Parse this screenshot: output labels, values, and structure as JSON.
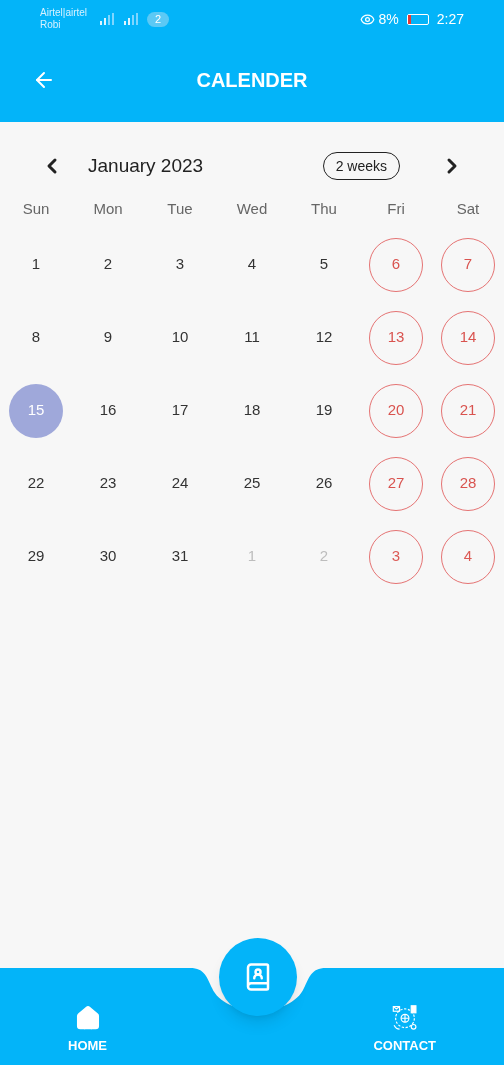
{
  "status_bar": {
    "carrier_1": "Airtel|airtel",
    "carrier_2": "Robi",
    "sim_badge": "2",
    "battery": "8%",
    "time": "2:27"
  },
  "app_bar": {
    "title": "CALENDER"
  },
  "calendar": {
    "month": "January 2023",
    "format_button": "2 weeks",
    "weekdays": [
      "Sun",
      "Mon",
      "Tue",
      "Wed",
      "Thu",
      "Fri",
      "Sat"
    ],
    "weeks": [
      [
        {
          "day": "1",
          "outside": false,
          "weekend": false,
          "selected": false
        },
        {
          "day": "2",
          "outside": false,
          "weekend": false,
          "selected": false
        },
        {
          "day": "3",
          "outside": false,
          "weekend": false,
          "selected": false
        },
        {
          "day": "4",
          "outside": false,
          "weekend": false,
          "selected": false
        },
        {
          "day": "5",
          "outside": false,
          "weekend": false,
          "selected": false
        },
        {
          "day": "6",
          "outside": false,
          "weekend": true,
          "selected": false
        },
        {
          "day": "7",
          "outside": false,
          "weekend": true,
          "selected": false
        }
      ],
      [
        {
          "day": "8",
          "outside": false,
          "weekend": false,
          "selected": false
        },
        {
          "day": "9",
          "outside": false,
          "weekend": false,
          "selected": false
        },
        {
          "day": "10",
          "outside": false,
          "weekend": false,
          "selected": false
        },
        {
          "day": "11",
          "outside": false,
          "weekend": false,
          "selected": false
        },
        {
          "day": "12",
          "outside": false,
          "weekend": false,
          "selected": false
        },
        {
          "day": "13",
          "outside": false,
          "weekend": true,
          "selected": false
        },
        {
          "day": "14",
          "outside": false,
          "weekend": true,
          "selected": false
        }
      ],
      [
        {
          "day": "15",
          "outside": false,
          "weekend": false,
          "selected": true
        },
        {
          "day": "16",
          "outside": false,
          "weekend": false,
          "selected": false
        },
        {
          "day": "17",
          "outside": false,
          "weekend": false,
          "selected": false
        },
        {
          "day": "18",
          "outside": false,
          "weekend": false,
          "selected": false
        },
        {
          "day": "19",
          "outside": false,
          "weekend": false,
          "selected": false
        },
        {
          "day": "20",
          "outside": false,
          "weekend": true,
          "selected": false
        },
        {
          "day": "21",
          "outside": false,
          "weekend": true,
          "selected": false
        }
      ],
      [
        {
          "day": "22",
          "outside": false,
          "weekend": false,
          "selected": false
        },
        {
          "day": "23",
          "outside": false,
          "weekend": false,
          "selected": false
        },
        {
          "day": "24",
          "outside": false,
          "weekend": false,
          "selected": false
        },
        {
          "day": "25",
          "outside": false,
          "weekend": false,
          "selected": false
        },
        {
          "day": "26",
          "outside": false,
          "weekend": false,
          "selected": false
        },
        {
          "day": "27",
          "outside": false,
          "weekend": true,
          "selected": false
        },
        {
          "day": "28",
          "outside": false,
          "weekend": true,
          "selected": false
        }
      ],
      [
        {
          "day": "29",
          "outside": false,
          "weekend": false,
          "selected": false
        },
        {
          "day": "30",
          "outside": false,
          "weekend": false,
          "selected": false
        },
        {
          "day": "31",
          "outside": false,
          "weekend": false,
          "selected": false
        },
        {
          "day": "1",
          "outside": true,
          "weekend": false,
          "selected": false
        },
        {
          "day": "2",
          "outside": true,
          "weekend": false,
          "selected": false
        },
        {
          "day": "3",
          "outside": true,
          "weekend": true,
          "selected": false
        },
        {
          "day": "4",
          "outside": true,
          "weekend": true,
          "selected": false
        }
      ]
    ]
  },
  "bottom_nav": {
    "items": [
      {
        "label": "HOME",
        "kind": "home"
      },
      {
        "label": "CONTACT",
        "kind": "contact"
      }
    ]
  }
}
